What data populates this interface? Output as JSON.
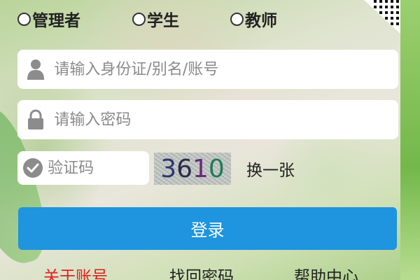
{
  "roles": [
    {
      "label": "管理者",
      "selected": false
    },
    {
      "label": "学生",
      "selected": false
    },
    {
      "label": "教师",
      "selected": false
    }
  ],
  "account_field": {
    "placeholder": "请输入身份证/别名/账号",
    "value": "",
    "icon": "user-icon"
  },
  "password_field": {
    "placeholder": "请输入密码",
    "value": "",
    "icon": "lock-icon"
  },
  "captcha": {
    "placeholder": "验证码",
    "value": "",
    "icon": "check-circle-icon",
    "image_text": [
      "3",
      "6",
      "1",
      "0"
    ],
    "refresh_label": "换一张"
  },
  "login_button": {
    "label": "登录",
    "color": "#1e95de"
  },
  "footer_links": [
    {
      "label": "关于账号",
      "color": "#e02020"
    },
    {
      "label": "找回密码",
      "color": "#222222"
    },
    {
      "label": "帮助中心",
      "color": "#222222"
    }
  ]
}
